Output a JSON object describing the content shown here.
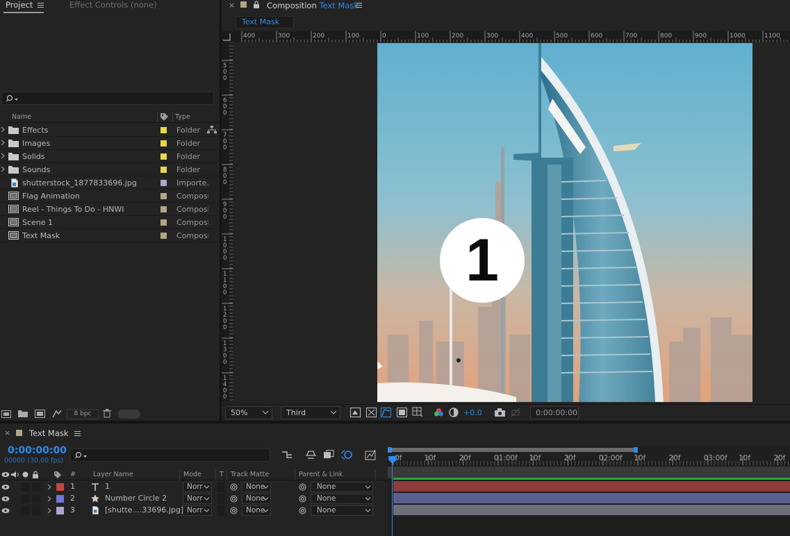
{
  "project_panel": {
    "tab_project": "Project",
    "tab_effects": "Effect Controls (none)",
    "columns": {
      "name": "Name",
      "type": "Type"
    },
    "items": [
      {
        "name": "Effects",
        "type": "Folder",
        "kind": "folder",
        "color": "#e6d74c",
        "expandable": true
      },
      {
        "name": "Images",
        "type": "Folder",
        "kind": "folder",
        "color": "#e6d74c",
        "expandable": true
      },
      {
        "name": "Solids",
        "type": "Folder",
        "kind": "folder",
        "color": "#e6d74c",
        "expandable": true
      },
      {
        "name": "Sounds",
        "type": "Folder",
        "kind": "folder",
        "color": "#e6d74c",
        "expandable": true
      },
      {
        "name": "shutterstock_1877833696.jpg",
        "type": "Importe...",
        "kind": "file",
        "color": "#a9a9c9",
        "expandable": false
      },
      {
        "name": "Flag Animation",
        "type": "Composi",
        "kind": "comp",
        "color": "#b4a586",
        "expandable": false
      },
      {
        "name": "Reel - Things To Do - HNWI",
        "type": "Composi",
        "kind": "comp",
        "color": "#b4a586",
        "expandable": false
      },
      {
        "name": "Scene 1",
        "type": "Composi",
        "kind": "comp",
        "color": "#b4a586",
        "expandable": false
      },
      {
        "name": "Text Mask",
        "type": "Composi",
        "kind": "comp",
        "color": "#b4a586",
        "expandable": false
      }
    ],
    "footer": {
      "bpc": "8 bpc"
    }
  },
  "composition_panel": {
    "header_prefix": "Composition",
    "header_name": "Text Mask",
    "sub_tab": "Text Mask",
    "ruler_labels": [
      "400",
      "300",
      "200",
      "100",
      "0",
      "100",
      "200",
      "300",
      "400",
      "500",
      "600",
      "700",
      "800",
      "900",
      "1000",
      "1100"
    ],
    "vruler_labels": [
      "5\n0\n0",
      "6\n0\n0",
      "7\n0\n0",
      "8\n0\n0",
      "9\n0\n0",
      "1\n0\n0\n0",
      "1\n1\n0\n0",
      "1\n2\n0\n0",
      "1\n3\n0\n0",
      "1\n4\n0\n0"
    ],
    "circle_text": "1",
    "controls": {
      "zoom": "50%",
      "resolution": "Third",
      "exposure": "+0.0",
      "timecode": "0:00:00:00"
    }
  },
  "timeline": {
    "tab": "Text Mask",
    "timecode": "0:00:00:00",
    "fps": "00000 (30.00 fps)",
    "columns": {
      "num": "#",
      "layer_name": "Layer Name",
      "mode": "Mode",
      "t": "T",
      "track_matte": "Track Matte",
      "parent": "Parent & Link"
    },
    "time_ticks": [
      "0f",
      "10f",
      "20f",
      "01:00f",
      "10f",
      "20f",
      "02:00f",
      "10f",
      "20f",
      "03:00f",
      "10f",
      "20f"
    ],
    "layers": [
      {
        "num": "1",
        "name": "1",
        "kind": "text",
        "color": "#c74444",
        "mode": "Norr",
        "matte": "None",
        "parent": "None",
        "bar_color": "#8e3b3b"
      },
      {
        "num": "2",
        "name": "Number Circle 2",
        "kind": "shape",
        "color": "#6b78d4",
        "mode": "Norr",
        "matte": "None",
        "parent": "None",
        "bar_color": "#5b5f8f"
      },
      {
        "num": "3",
        "name": "[shutte....33696.jpg]",
        "kind": "footage",
        "color": "#a9a9c9",
        "mode": "Norr",
        "matte": "None",
        "parent": "None",
        "bar_color": "#6e6e7c"
      }
    ]
  }
}
